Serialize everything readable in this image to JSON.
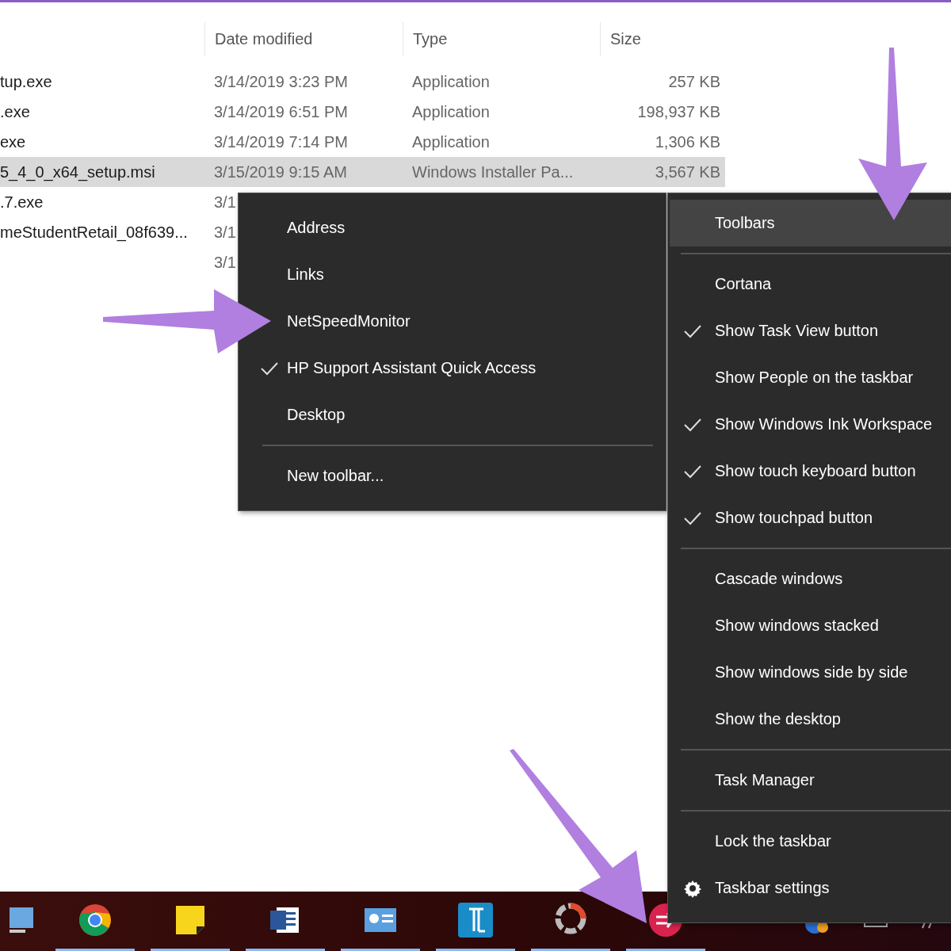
{
  "file_list": {
    "columns": [
      {
        "label": "Date modified"
      },
      {
        "label": "Type"
      },
      {
        "label": "Size"
      }
    ],
    "rows": [
      {
        "name": "tup.exe",
        "date": "3/14/2019 3:23 PM",
        "type": "Application",
        "size": "257 KB",
        "selected": false
      },
      {
        "name": ".exe",
        "date": "3/14/2019 6:51 PM",
        "type": "Application",
        "size": "198,937 KB",
        "selected": false
      },
      {
        "name": "exe",
        "date": "3/14/2019 7:14 PM",
        "type": "Application",
        "size": "1,306 KB",
        "selected": false
      },
      {
        "name": "5_4_0_x64_setup.msi",
        "date": "3/15/2019 9:15 AM",
        "type": "Windows Installer Pa...",
        "size": "3,567 KB",
        "selected": true
      },
      {
        "name": ".7.exe",
        "date": "3/1",
        "selected": false
      },
      {
        "name": "meStudentRetail_08f639...",
        "date": "3/1",
        "selected": false
      },
      {
        "date": "3/1",
        "selected": false
      }
    ]
  },
  "toolbars_menu": {
    "items": [
      {
        "kind": "item",
        "label": "Address",
        "checked": false
      },
      {
        "kind": "item",
        "label": "Links",
        "checked": false
      },
      {
        "kind": "item",
        "label": "NetSpeedMonitor",
        "checked": false
      },
      {
        "kind": "item",
        "label": "HP Support Assistant Quick Access",
        "checked": true
      },
      {
        "kind": "item",
        "label": "Desktop",
        "checked": false
      },
      {
        "kind": "separator"
      },
      {
        "kind": "item",
        "label": "New toolbar...",
        "checked": false
      }
    ]
  },
  "taskbar_menu": {
    "items": [
      {
        "kind": "item",
        "label": "Toolbars",
        "checked": false,
        "selected": true
      },
      {
        "kind": "separator"
      },
      {
        "kind": "item",
        "label": "Cortana",
        "checked": false,
        "selected": false
      },
      {
        "kind": "item",
        "label": "Show Task View button",
        "checked": true,
        "selected": false
      },
      {
        "kind": "item",
        "label": "Show People on the taskbar",
        "checked": false,
        "selected": false
      },
      {
        "kind": "item",
        "label": "Show Windows Ink Workspace",
        "checked": true,
        "selected": false
      },
      {
        "kind": "item",
        "label": "Show touch keyboard button",
        "checked": true,
        "selected": false
      },
      {
        "kind": "item",
        "label": "Show touchpad button",
        "checked": true,
        "selected": false
      },
      {
        "kind": "separator"
      },
      {
        "kind": "item",
        "label": "Cascade windows",
        "checked": false,
        "selected": false
      },
      {
        "kind": "item",
        "label": "Show windows stacked",
        "checked": false,
        "selected": false
      },
      {
        "kind": "item",
        "label": "Show windows side by side",
        "checked": false,
        "selected": false
      },
      {
        "kind": "item",
        "label": "Show the desktop",
        "checked": false,
        "selected": false
      },
      {
        "kind": "separator"
      },
      {
        "kind": "item",
        "label": "Task Manager",
        "checked": false,
        "selected": false
      },
      {
        "kind": "separator"
      },
      {
        "kind": "item",
        "label": "Lock the taskbar",
        "checked": false,
        "selected": false
      },
      {
        "kind": "settings",
        "label": "Taskbar settings",
        "selected": false
      }
    ]
  },
  "taskbar": {
    "apps": [
      {
        "kind": "computer",
        "running": false
      },
      {
        "kind": "chrome",
        "running": true
      },
      {
        "kind": "sticky",
        "running": true
      },
      {
        "kind": "word",
        "running": true
      },
      {
        "kind": "panel",
        "running": true
      },
      {
        "kind": "typing",
        "running": true
      },
      {
        "kind": "photo",
        "running": true
      },
      {
        "kind": "red",
        "running": true
      }
    ]
  }
}
